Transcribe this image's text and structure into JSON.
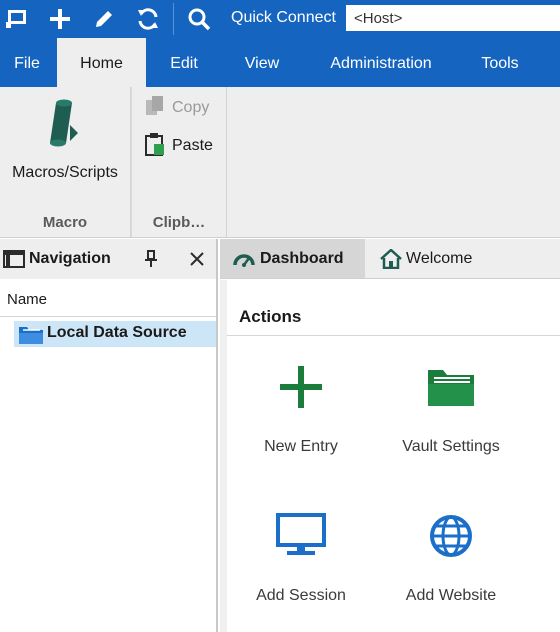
{
  "quick_access": {
    "icons": [
      "new-session-icon",
      "add-icon",
      "edit-icon",
      "refresh-icon",
      "search-icon"
    ],
    "quick_connect_label": "Quick Connect",
    "host_placeholder": "<Host>"
  },
  "ribbon_tabs": [
    {
      "label": "File"
    },
    {
      "label": "Home"
    },
    {
      "label": "Edit"
    },
    {
      "label": "View"
    },
    {
      "label": "Administration"
    },
    {
      "label": "Tools"
    }
  ],
  "active_ribbon_tab": "Home",
  "ribbon": {
    "macro_group": {
      "label": "Macro",
      "button_label": "Macros/Scripts"
    },
    "clipboard_group": {
      "label": "Clipb…",
      "copy_label": "Copy",
      "paste_label": "Paste"
    }
  },
  "navigation": {
    "title": "Navigation",
    "column_header": "Name",
    "items": [
      {
        "label": "Local Data Source"
      }
    ]
  },
  "document_tabs": [
    {
      "label": "Dashboard"
    },
    {
      "label": "Welcome"
    }
  ],
  "active_document_tab": "Dashboard",
  "dashboard": {
    "section_title": "Actions",
    "actions": [
      {
        "label": "New Entry",
        "icon": "plus-icon"
      },
      {
        "label": "Vault Settings",
        "icon": "folder-icon"
      },
      {
        "label": "Add Session",
        "icon": "monitor-icon"
      },
      {
        "label": "Add Website",
        "icon": "globe-icon"
      }
    ]
  },
  "colors": {
    "accent_blue": "#1565c0",
    "action_green": "#1b7d3b",
    "action_blue": "#1a6fc9",
    "selection": "#cde6f7"
  }
}
